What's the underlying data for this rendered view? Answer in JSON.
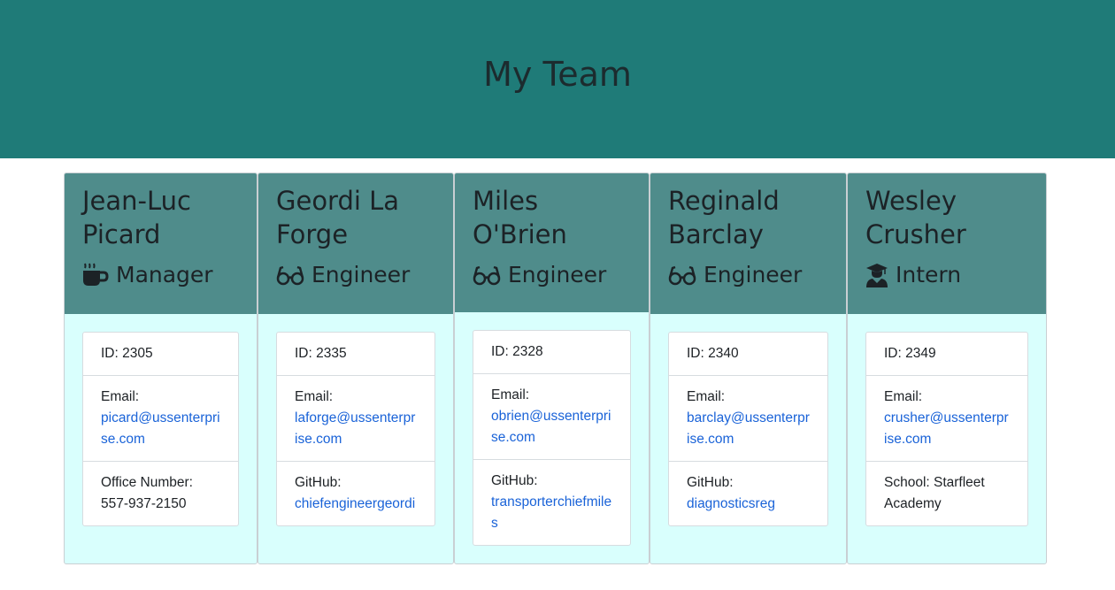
{
  "header": {
    "title": "My Team"
  },
  "employees": [
    {
      "name_line1": "Jean-Luc",
      "name_line2": "Picard",
      "role": "Manager",
      "icon": "coffee-icon",
      "id_text": "ID: 2305",
      "email_label": "Email:",
      "email": "picard@ussenterprise.com",
      "extra_label": "Office Number:",
      "extra_value": "557-937-2150"
    },
    {
      "name_line1": "Geordi La",
      "name_line2": "Forge",
      "role": "Engineer",
      "icon": "glasses-icon",
      "id_text": "ID: 2335",
      "email_label": "Email:",
      "email": "laforge@ussenterprise.com",
      "extra_label": "GitHub:",
      "extra_value": "chiefengineergeordi"
    },
    {
      "name_line1": "Miles",
      "name_line2": "O'Brien",
      "role": "Engineer",
      "icon": "glasses-icon",
      "id_text": "ID: 2328",
      "email_label": "Email:",
      "email": "obrien@ussenterprise.com",
      "extra_label": "GitHub:",
      "extra_value": "transporterchiefmiles"
    },
    {
      "name_line1": "Reginald",
      "name_line2": "Barclay",
      "role": "Engineer",
      "icon": "glasses-icon",
      "id_text": "ID: 2340",
      "email_label": "Email:",
      "email": "barclay@ussenterprise.com",
      "extra_label": "GitHub:",
      "extra_value": "diagnosticsreg"
    },
    {
      "name_line1": "Wesley",
      "name_line2": "Crusher",
      "role": "Intern",
      "icon": "graduate-icon",
      "id_text": "ID: 2349",
      "email_label": "Email:",
      "email": "crusher@ussenterprise.com",
      "extra_label": "School: Starfleet Academy",
      "extra_value": ""
    }
  ]
}
